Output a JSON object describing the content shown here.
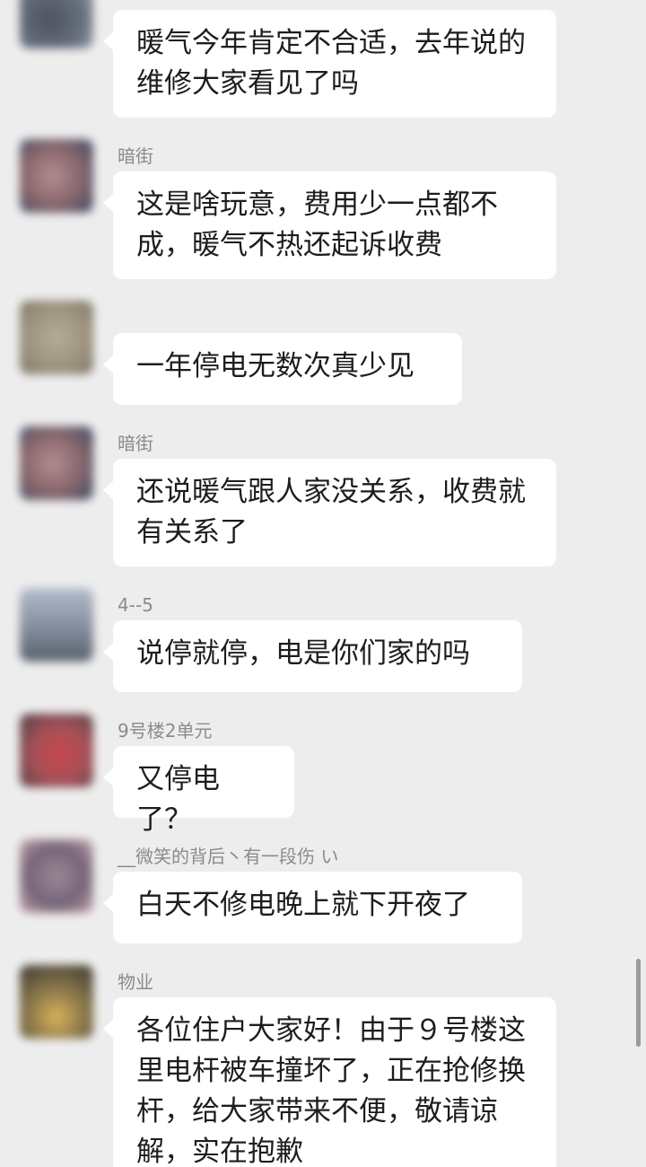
{
  "messages": [
    {
      "name": "",
      "text": "暖气今年肯定不合适，去年说的维修大家看见了吗",
      "avatar_color": "#5d6675"
    },
    {
      "name": "暗街",
      "text": "这是啥玩意，费用少一点都不成，暖气不热还起诉收费",
      "avatar_color": "#7c5a60"
    },
    {
      "name": "",
      "text": "一年停电无数次真少见",
      "avatar_color": "#958a74"
    },
    {
      "name": "暗街",
      "text": "还说暖气跟人家没关系，收费就有关系了",
      "avatar_color": "#7c5a60"
    },
    {
      "name": "4--5",
      "text": "说停就停，电是你们家的吗",
      "avatar_color": "#7a8596"
    },
    {
      "name": "9号楼2单元",
      "text": "又停电了？",
      "avatar_color": "#a3444c"
    },
    {
      "name": "__微笑的背后丶有一段伤 い",
      "text": "白天不修电晚上就下开夜了",
      "avatar_color": "#6c5a70"
    },
    {
      "name": "物业",
      "text": "各位住户大家好！由于９号楼这里电杆被车撞坏了，正在抢修换杆，给大家带来不便，敬请谅解，实在抱歉",
      "avatar_color": "#8a7440"
    }
  ]
}
